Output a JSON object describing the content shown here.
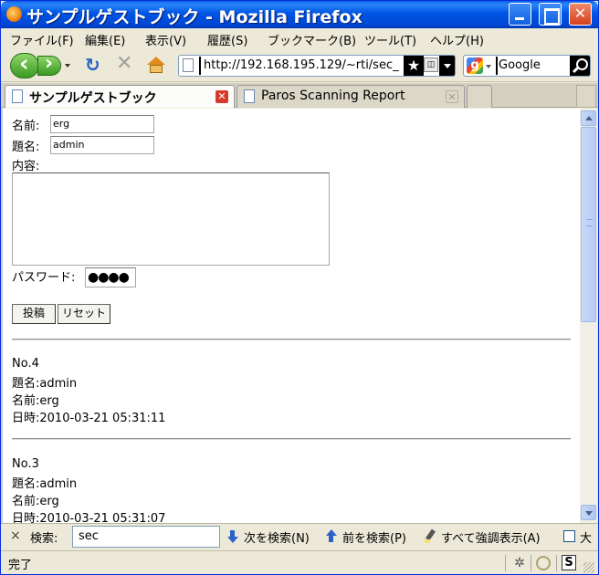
{
  "window": {
    "title": "サンプルゲストブック - Mozilla Firefox"
  },
  "menu": [
    "ファイル(F)",
    "編集(E)",
    "表示(V)",
    "履歴(S)",
    "ブックマーク(B)",
    "ツール(T)",
    "ヘルプ(H)"
  ],
  "nav": {
    "url": "http://192.168.195.129/~rti/sec_",
    "search_engine": "Google",
    "search_value": ""
  },
  "tabs": [
    {
      "label": "サンプルゲストブック",
      "active": true
    },
    {
      "label": "Paros Scanning Report",
      "active": false
    }
  ],
  "form": {
    "name_label": "名前:",
    "name_value": "erg",
    "subject_label": "題名:",
    "subject_value": "admin",
    "content_label": "内容:",
    "content_value": "",
    "password_label": "パスワード:",
    "password_value": "●●●●",
    "submit_label": "投稿",
    "reset_label": "リセット"
  },
  "posts": [
    {
      "no": "No.4",
      "subject": "題名:admin",
      "name": "名前:erg",
      "datetime": "日時:2010-03-21 05:31:11"
    },
    {
      "no": "No.3",
      "subject": "題名:admin",
      "name": "名前:erg",
      "datetime": "日時:2010-03-21 05:31:07"
    }
  ],
  "findbar": {
    "close": "×",
    "label": "検索:",
    "value": "sec",
    "next": "次を検索(N)",
    "prev": "前を検索(P)",
    "highlight": "すべて強調表示(A)",
    "match_case": "大"
  },
  "status": {
    "text": "完了",
    "s_label": "S"
  }
}
